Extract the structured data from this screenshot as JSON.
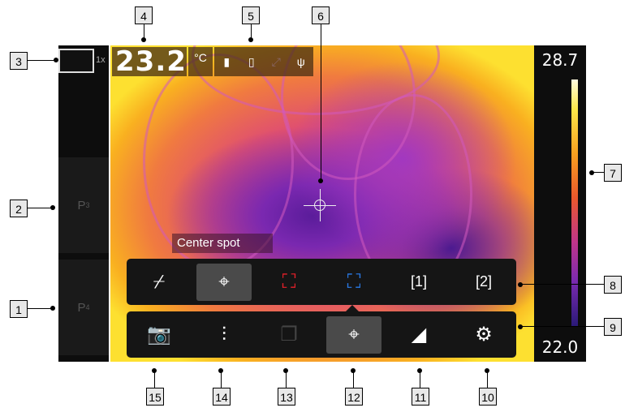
{
  "sidebar": {
    "zoom_label": "1x",
    "presets": [
      {
        "letter": "P",
        "number": "3"
      },
      {
        "letter": "P",
        "number": "4"
      }
    ]
  },
  "readout": {
    "temperature": "23.2",
    "unit": "°C"
  },
  "tooltip": "Center spot",
  "scale": {
    "max": "28.7",
    "min": "22.0"
  },
  "measure_toolbar": {
    "items": [
      {
        "icon": "no-measurement-icon",
        "glyph": "⌿"
      },
      {
        "icon": "center-spot-icon",
        "glyph": "⌖"
      },
      {
        "icon": "hot-spot-icon",
        "glyph": "⛶"
      },
      {
        "icon": "cold-spot-icon",
        "glyph": "⛶"
      },
      {
        "icon": "user-preset-1-icon",
        "glyph": "[1]"
      },
      {
        "icon": "user-preset-2-icon",
        "glyph": "[2]"
      }
    ]
  },
  "main_toolbar": {
    "items": [
      {
        "icon": "camera-icon",
        "glyph": "📷"
      },
      {
        "icon": "image-mode-icon",
        "glyph": "⫶"
      },
      {
        "icon": "overlay-icon",
        "glyph": "❐"
      },
      {
        "icon": "measurement-icon",
        "glyph": "⌖"
      },
      {
        "icon": "color-palette-icon",
        "glyph": "◢"
      },
      {
        "icon": "settings-icon",
        "glyph": "⚙"
      }
    ]
  },
  "colors": {
    "hot_spot": "#e8202a",
    "cold_spot": "#2a7be8",
    "toolbar_bg": "#151515"
  },
  "callouts": [
    "1",
    "2",
    "3",
    "4",
    "5",
    "6",
    "7",
    "8",
    "9",
    "10",
    "11",
    "12",
    "13",
    "14",
    "15"
  ]
}
